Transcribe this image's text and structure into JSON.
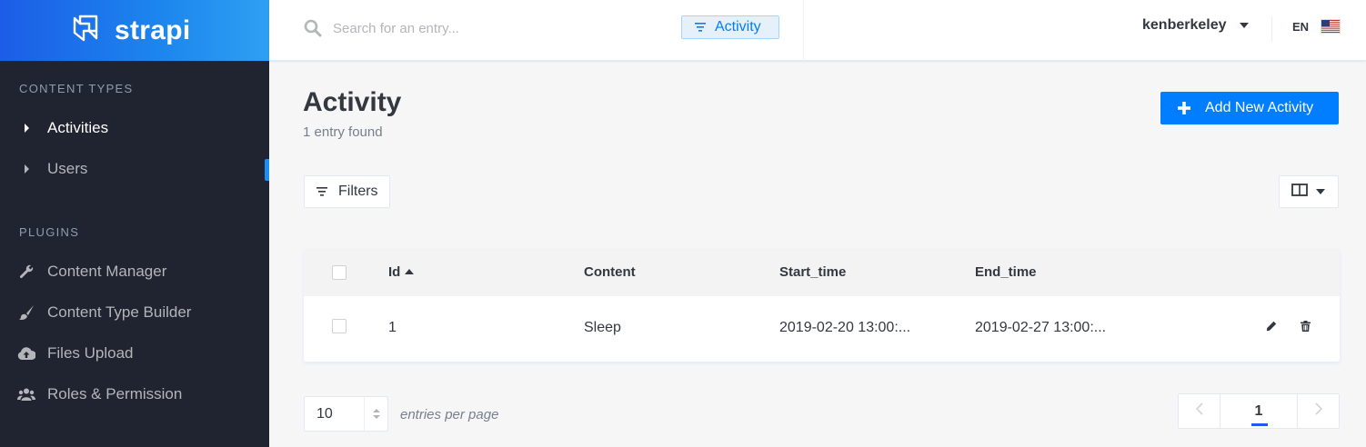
{
  "brand": {
    "name": "strapi"
  },
  "sidebar": {
    "content_types_title": "Content Types",
    "content_types": [
      {
        "label": "Activities",
        "active": true
      },
      {
        "label": "Users",
        "active": false
      }
    ],
    "plugins_title": "Plugins",
    "plugins": [
      {
        "label": "Content Manager",
        "icon": "wrench-icon"
      },
      {
        "label": "Content Type Builder",
        "icon": "paint-brush-icon"
      },
      {
        "label": "Files Upload",
        "icon": "cloud-upload-icon"
      },
      {
        "label": "Roles & Permission",
        "icon": "users-icon"
      }
    ]
  },
  "header": {
    "search_placeholder": "Search for an entry...",
    "filter_tag": "Activity",
    "username": "kenberkeley",
    "language": "EN"
  },
  "main": {
    "title": "Activity",
    "subtitle": "1 entry found",
    "add_button": "Add New Activity",
    "filters_button": "Filters"
  },
  "table": {
    "columns": [
      "Id",
      "Content",
      "Start_time",
      "End_time"
    ],
    "sort_column": "Id",
    "rows": [
      {
        "id": "1",
        "content": "Sleep",
        "start_time": "2019-02-20 13:00:...",
        "end_time": "2019-02-27 13:00:..."
      }
    ]
  },
  "footer": {
    "per_page_value": "10",
    "per_page_label": "entries per page",
    "current_page": "1"
  },
  "colors": {
    "primary": "#007eff",
    "sidebar_bg": "#1f2430",
    "brand_gradient_start": "#1c5de7"
  }
}
